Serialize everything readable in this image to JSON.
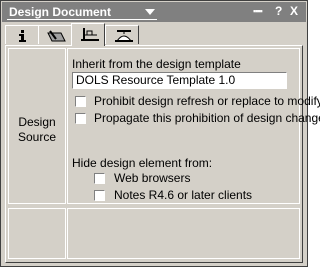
{
  "window": {
    "title": "Design Document"
  },
  "titlebar_icons": [
    "dots-icon",
    "help-icon",
    "close-icon"
  ],
  "titlebar_text": {
    "help": "?",
    "close": "X"
  },
  "tabs": [
    {
      "name": "tab-info",
      "icon": "info-icon",
      "glyph": "i"
    },
    {
      "name": "tab-fields",
      "icon": "field-icon"
    },
    {
      "name": "tab-design",
      "icon": "design-tool-icon"
    },
    {
      "name": "tab-hide",
      "icon": "propeller-hat-icon"
    }
  ],
  "section": {
    "label_line1": "Design",
    "label_line2": "Source"
  },
  "inherit": {
    "label": "Inherit from the design template",
    "value": "DOLS Resource Template 1.0"
  },
  "options": {
    "prohibit": "Prohibit design refresh or replace to modify",
    "propagate": "Propagate this prohibition of design change"
  },
  "hide": {
    "label": "Hide design element from:",
    "web": "Web browsers",
    "notes": "Notes R4.6 or later clients"
  }
}
